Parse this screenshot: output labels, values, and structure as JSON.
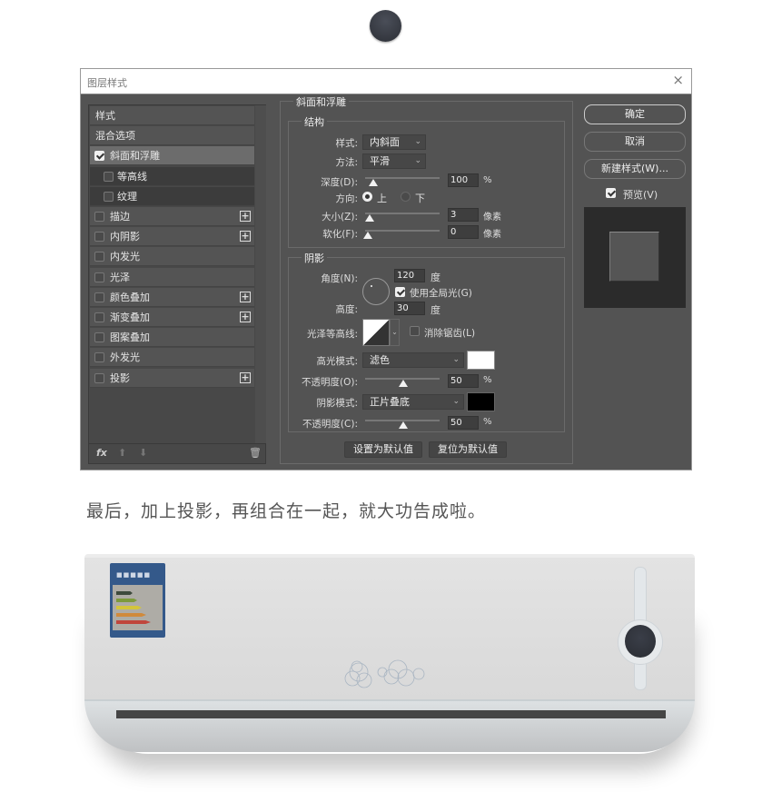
{
  "dialog": {
    "title": "图层样式",
    "close": "×"
  },
  "sidebar": {
    "items": [
      {
        "label": "样式",
        "checkbox": false
      },
      {
        "label": "混合选项",
        "checkbox": false
      },
      {
        "label": "斜面和浮雕",
        "checkbox": true,
        "checked": true,
        "selected": true
      },
      {
        "label": "等高线",
        "checkbox": true,
        "checked": false,
        "sub": true
      },
      {
        "label": "纹理",
        "checkbox": true,
        "checked": false,
        "sub": true
      },
      {
        "label": "描边",
        "checkbox": true,
        "checked": false,
        "plus": true
      },
      {
        "label": "内阴影",
        "checkbox": true,
        "checked": false,
        "plus": true
      },
      {
        "label": "内发光",
        "checkbox": true,
        "checked": false
      },
      {
        "label": "光泽",
        "checkbox": true,
        "checked": false
      },
      {
        "label": "颜色叠加",
        "checkbox": true,
        "checked": false,
        "plus": true
      },
      {
        "label": "渐变叠加",
        "checkbox": true,
        "checked": false,
        "plus": true
      },
      {
        "label": "图案叠加",
        "checkbox": true,
        "checked": false
      },
      {
        "label": "外发光",
        "checkbox": true,
        "checked": false
      },
      {
        "label": "投影",
        "checkbox": true,
        "checked": false,
        "plus": true
      }
    ],
    "fx": "fx"
  },
  "bevel": {
    "title": "斜面和浮雕",
    "structure": {
      "title": "结构",
      "style_label": "样式:",
      "style_value": "内斜面",
      "technique_label": "方法:",
      "technique_value": "平滑",
      "depth_label": "深度(D):",
      "depth_value": "100",
      "depth_unit": "%",
      "direction_label": "方向:",
      "dir_up": "上",
      "dir_down": "下",
      "size_label": "大小(Z):",
      "size_value": "3",
      "size_unit": "像素",
      "soften_label": "软化(F):",
      "soften_value": "0",
      "soften_unit": "像素"
    },
    "shading": {
      "title": "阴影",
      "angle_label": "角度(N):",
      "angle_value": "120",
      "angle_unit": "度",
      "global_light": "使用全局光(G)",
      "altitude_label": "高度:",
      "altitude_value": "30",
      "altitude_unit": "度",
      "gloss_label": "光泽等高线:",
      "antialias": "消除锯齿(L)",
      "highlight_label": "高光模式:",
      "highlight_value": "滤色",
      "highlight_color": "#ffffff",
      "h_opacity_label": "不透明度(O):",
      "h_opacity_value": "50",
      "pct": "%",
      "shadow_label": "阴影模式:",
      "shadow_value": "正片叠底",
      "shadow_color": "#000000",
      "s_opacity_label": "不透明度(C):",
      "s_opacity_value": "50"
    },
    "make_default": "设置为默认值",
    "reset_default": "复位为默认值"
  },
  "right": {
    "ok": "确定",
    "cancel": "取消",
    "new_style": "新建样式(W)...",
    "preview": "预览(V)"
  },
  "caption": "最后，加上投影，再组合在一起，就大功告成啦。",
  "energy_label_colors": [
    "#3d4a3c",
    "#7d9a3c",
    "#d3c53c",
    "#d08a3c",
    "#c0463c"
  ]
}
